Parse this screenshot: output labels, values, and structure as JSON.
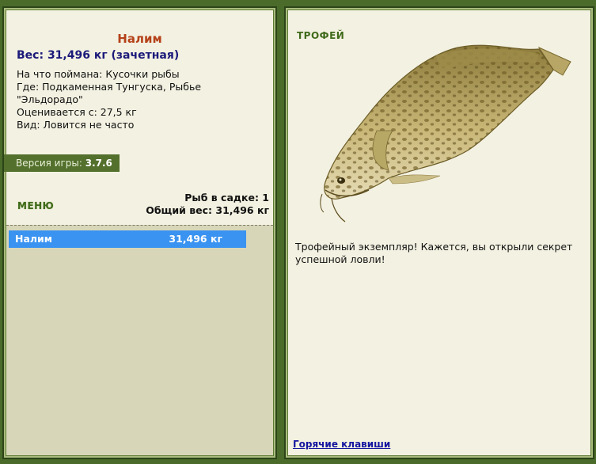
{
  "fish": {
    "name": "Налим",
    "weight_line": "Вес: 31,496 кг (зачетная)",
    "bait_line": "На что поймана: Кусочки рыбы",
    "place_line": "Где: Подкаменная Тунгуска, Рыбье \"Эльдорадо\"",
    "rated_line": "Оценивается с: 27,5 кг",
    "kind_line": "Вид: Ловится не часто"
  },
  "version": {
    "label": "Версия игры:",
    "value": "3.7.6"
  },
  "menu": {
    "label": "МЕНЮ"
  },
  "stats": {
    "fish_count_line": "Рыб в садке: 1",
    "total_weight_line": "Общий вес: 31,496 кг"
  },
  "catch_list": [
    {
      "name": "Налим",
      "weight": "31,496 кг",
      "selected": true
    }
  ],
  "trophy": {
    "label": "ТРОФЕЙ",
    "message": "Трофейный экземпляр! Кажется, вы открыли секрет успешной ловли!"
  },
  "hotkeys_link": "Горячие клавиши"
}
